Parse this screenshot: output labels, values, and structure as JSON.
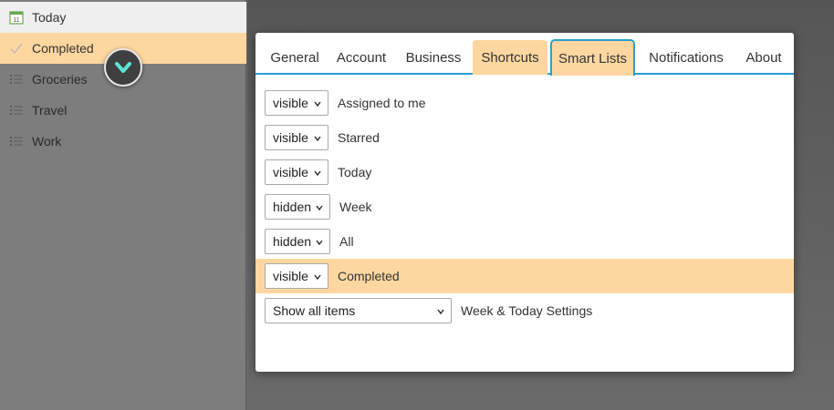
{
  "sidebar": {
    "items": [
      {
        "label": "Today",
        "icon": "calendar-icon",
        "icon_text": "11"
      },
      {
        "label": "Completed",
        "icon": "checkmark-icon"
      },
      {
        "label": "Groceries",
        "icon": "list-icon"
      },
      {
        "label": "Travel",
        "icon": "list-icon"
      },
      {
        "label": "Work",
        "icon": "list-icon"
      }
    ]
  },
  "drag_badge": {
    "icon": "chevron-down-icon"
  },
  "dialog": {
    "tabs": [
      {
        "label": "General"
      },
      {
        "label": "Account"
      },
      {
        "label": "Business"
      },
      {
        "label": "Shortcuts"
      },
      {
        "label": "Smart Lists"
      },
      {
        "label": "Notifications"
      },
      {
        "label": "About"
      }
    ],
    "active_tab": "Smart Lists",
    "rows": [
      {
        "value": "visible",
        "label": "Assigned to me"
      },
      {
        "value": "visible",
        "label": "Starred"
      },
      {
        "value": "visible",
        "label": "Today"
      },
      {
        "value": "hidden",
        "label": "Week"
      },
      {
        "value": "hidden",
        "label": "All"
      },
      {
        "value": "visible",
        "label": "Completed"
      }
    ],
    "week_today": {
      "value": "Show all items",
      "label": "Week & Today Settings"
    }
  },
  "colors": {
    "accent": "#2a9fd0",
    "highlight": "#fed7a0",
    "badge_chevron": "#5fe3d6"
  }
}
